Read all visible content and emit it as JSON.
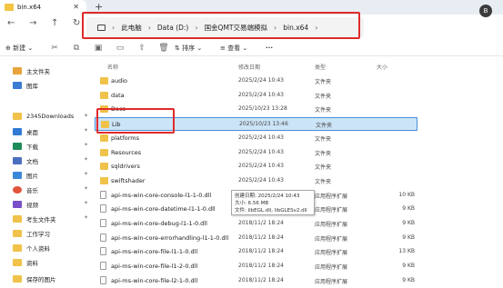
{
  "tab": {
    "title": "bin.x64",
    "close": "✕",
    "new": "+"
  },
  "user_badge": "B",
  "nav": {
    "back": "←",
    "forward": "→",
    "up": "↑",
    "refresh": "↻"
  },
  "breadcrumb": [
    "此电脑",
    "Data (D:)",
    "国金QMT交易端模拟",
    "bin.x64"
  ],
  "toolbar": {
    "new_label": "新建",
    "sort_label": "排序",
    "view_label": "查看",
    "more": "···"
  },
  "sidebar": {
    "top": [
      {
        "label": "主文件夹",
        "color": "#e8a43c"
      },
      {
        "label": "图库",
        "color": "#3b7bd4"
      }
    ],
    "pinned": [
      {
        "label": "2345Downloads",
        "color": "#f0c24a"
      },
      {
        "label": "桌面",
        "color": "#2f7bd6"
      },
      {
        "label": "下载",
        "color": "#1e8c5a"
      },
      {
        "label": "文档",
        "color": "#4c6fbf"
      },
      {
        "label": "图片",
        "color": "#3b88d8"
      },
      {
        "label": "音乐",
        "color": "#e0543c"
      },
      {
        "label": "视频",
        "color": "#7a4fc9"
      },
      {
        "label": "考生文件夹",
        "color": "#f0c24a"
      },
      {
        "label": "工作学习",
        "color": "#f0c24a"
      },
      {
        "label": "个人资料",
        "color": "#f0c24a"
      },
      {
        "label": "资料",
        "color": "#f0c24a"
      },
      {
        "label": "保存的图片",
        "color": "#f0c24a"
      }
    ]
  },
  "columns": {
    "name": "名称",
    "date": "修改日期",
    "type": "类型",
    "size": "大小"
  },
  "files": [
    {
      "name": "audio",
      "date": "2025/2/24 10:43",
      "type": "文件夹",
      "size": "",
      "kind": "folder"
    },
    {
      "name": "data",
      "date": "2025/2/24 10:43",
      "type": "文件夹",
      "size": "",
      "kind": "folder"
    },
    {
      "name": "Docs",
      "date": "2025/10/23 13:28",
      "type": "文件夹",
      "size": "",
      "kind": "folder"
    },
    {
      "name": "Lib",
      "date": "2025/10/23 13:46",
      "type": "文件夹",
      "size": "",
      "kind": "folder"
    },
    {
      "name": "platforms",
      "date": "2025/2/24 10:43",
      "type": "文件夹",
      "size": "",
      "kind": "folder"
    },
    {
      "name": "Resources",
      "date": "2025/2/24 10:43",
      "type": "文件夹",
      "size": "",
      "kind": "folder"
    },
    {
      "name": "sqldrivers",
      "date": "2025/2/24 10:43",
      "type": "文件夹",
      "size": "",
      "kind": "folder"
    },
    {
      "name": "swiftshader",
      "date": "2025/2/24 10:43",
      "type": "文件夹",
      "size": "",
      "kind": "folder"
    },
    {
      "name": "api-ms-win-core-console-l1-1-0.dll",
      "date": "2018/11/2 18:24",
      "type": "应用程序扩展",
      "size": "10 KB",
      "kind": "dll"
    },
    {
      "name": "api-ms-win-core-datetime-l1-1-0.dll",
      "date": "",
      "type": "应用程序扩展",
      "size": "9 KB",
      "kind": "dll"
    },
    {
      "name": "api-ms-win-core-debug-l1-1-0.dll",
      "date": "2018/11/2 18:24",
      "type": "应用程序扩展",
      "size": "9 KB",
      "kind": "dll"
    },
    {
      "name": "api-ms-win-core-errorhandling-l1-1-0.dll",
      "date": "2018/11/2 18:24",
      "type": "应用程序扩展",
      "size": "9 KB",
      "kind": "dll"
    },
    {
      "name": "api-ms-win-core-file-l1-1-0.dll",
      "date": "2018/11/2 18:24",
      "type": "应用程序扩展",
      "size": "13 KB",
      "kind": "dll"
    },
    {
      "name": "api-ms-win-core-file-l1-2-0.dll",
      "date": "2018/11/2 18:24",
      "type": "应用程序扩展",
      "size": "9 KB",
      "kind": "dll"
    },
    {
      "name": "api-ms-win-core-file-l2-1-0.dll",
      "date": "2018/11/2 18:24",
      "type": "应用程序扩展",
      "size": "9 KB",
      "kind": "dll"
    }
  ],
  "tooltip": {
    "line1": "创建日期: 2025/2/24 10:43",
    "line2": "大小: 6.56 MB",
    "line3": "文件: libEGL.dll, libGLESv2.dll"
  },
  "colors": {
    "selection": "#cce4f7",
    "highlight_box": "#e02a2a",
    "folder": "#f0c24a"
  }
}
